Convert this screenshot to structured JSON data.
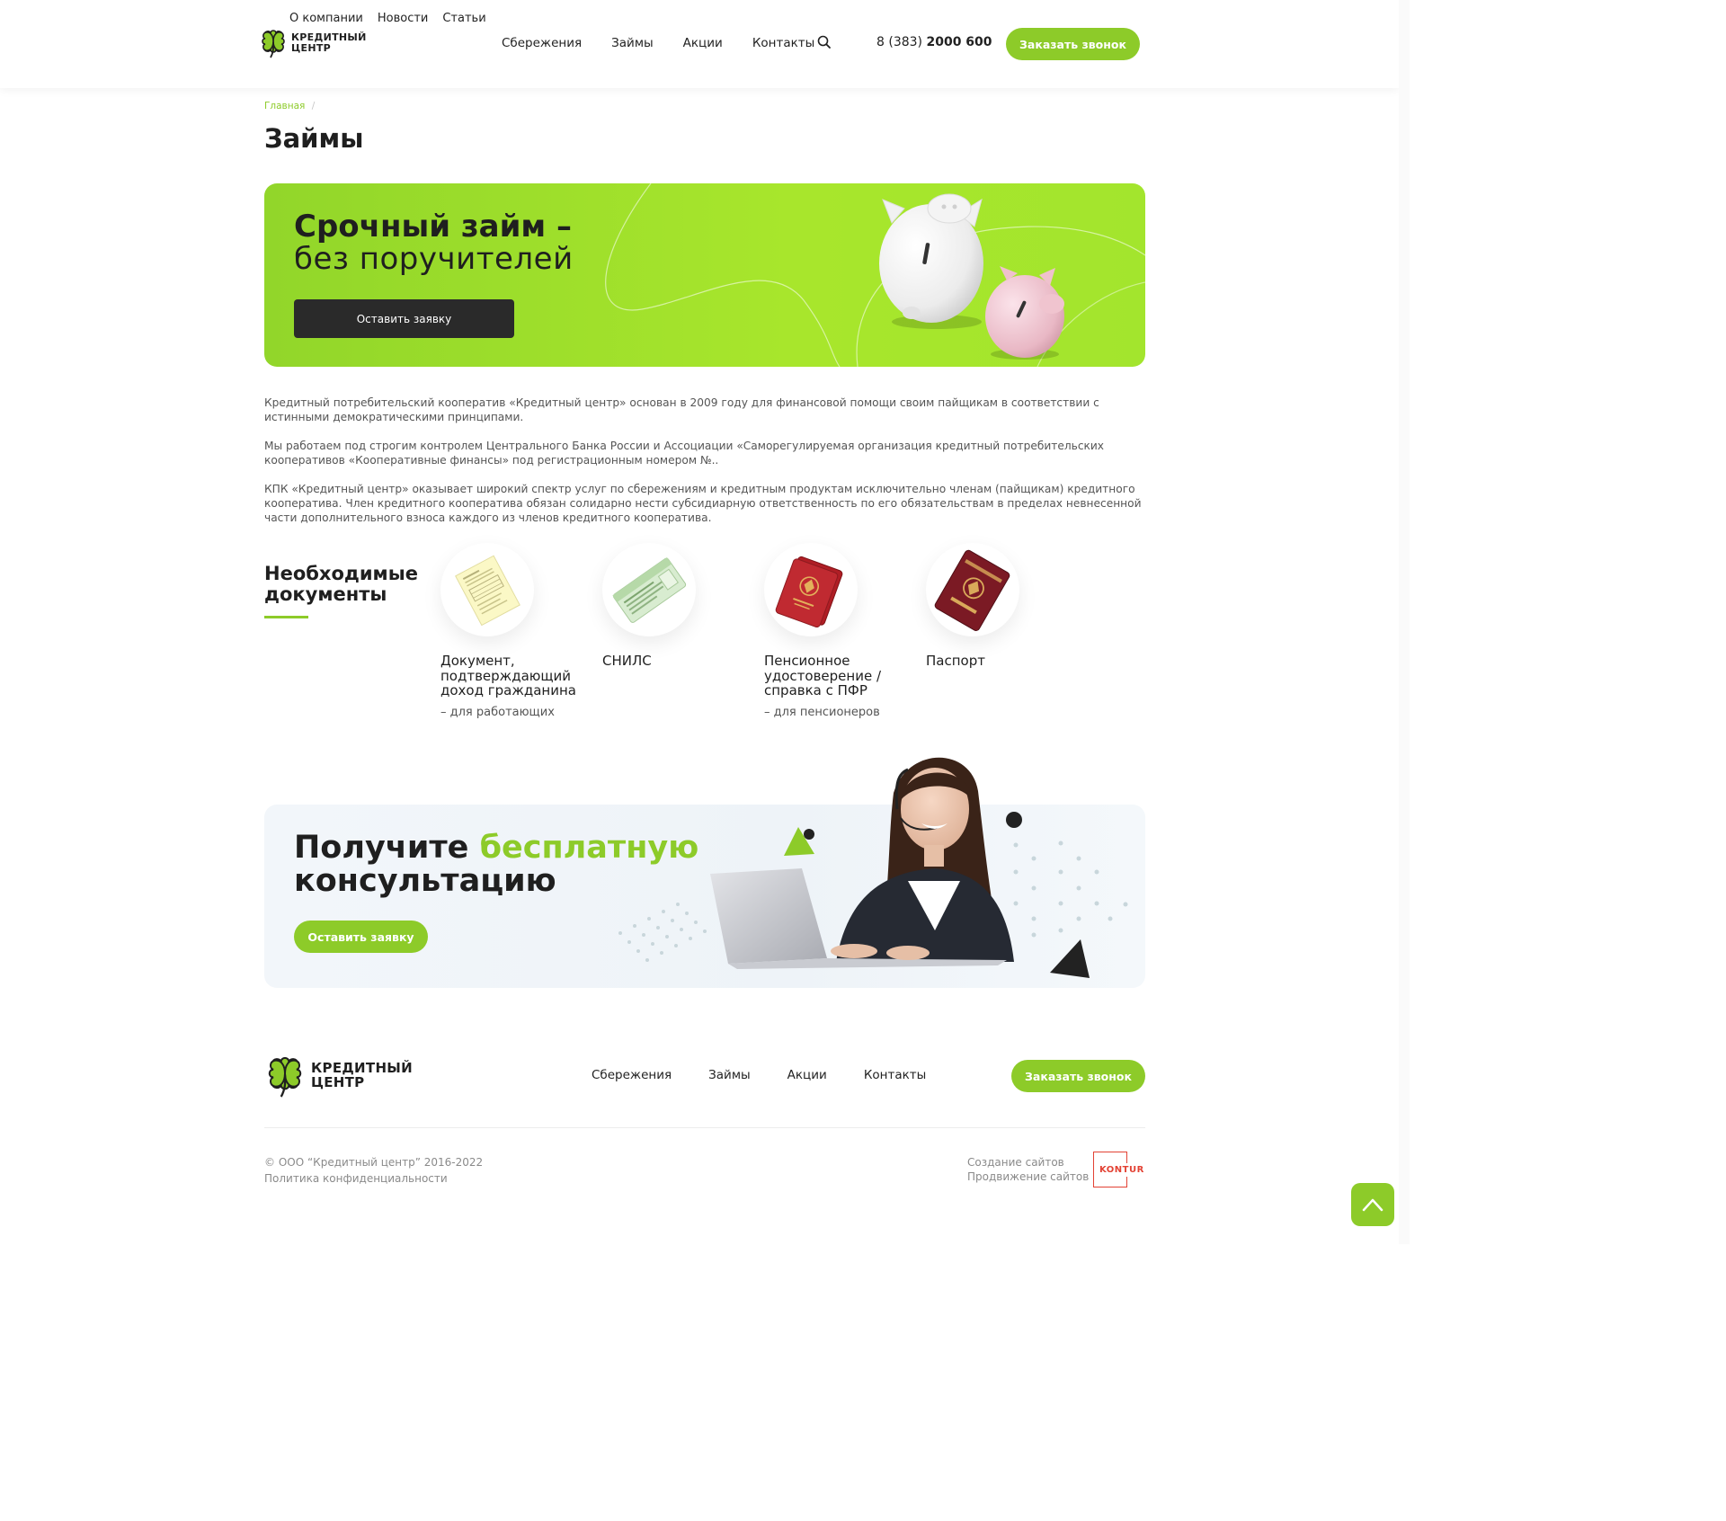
{
  "header": {
    "logo_text": [
      "КРЕДИТНЫЙ",
      "ЦЕНТР"
    ],
    "top_links": [
      "О компании",
      "Новости",
      "Статьи"
    ],
    "nav": [
      "Сбережения",
      "Займы",
      "Акции",
      "Контакты"
    ],
    "phone_prefix": "8 (383)",
    "phone_main": "2000 600",
    "call_button": "Заказать звонок"
  },
  "breadcrumb": {
    "home": "Главная",
    "separator": "/"
  },
  "page_title": "Займы",
  "hero": {
    "title_line1": "Срочный займ –",
    "title_line2": "без поручителей",
    "button": "Оставить заявку"
  },
  "about": [
    "Кредитный потребительский кооператив «Кредитный центр» основан в 2009 году для финансовой помощи своим пайщикам в соответствии с истинными демократическими принципами.",
    "Мы работаем под строгим контролем Центрального Банка России и Ассоциации «Саморегулируемая организация кредитный потребительских кооперативов «Кооперативные финансы» под регистрационным номером №..",
    "КПК «Кредитный центр» оказывает широкий спектр услуг по сбережениям и кредитным продуктам исключительно членам (пайщикам) кредитного кооператива. Член кредитного кооператива обязан солидарно нести субсидиарную ответственность по его обязательствам в пределах невнесенной части дополнительного взноса каждого из членов кредитного кооператива."
  ],
  "documents": {
    "heading_line1": "Необходимые",
    "heading_line2": "документы",
    "items": [
      {
        "title": "Документ, подтверждающий доход гражданина",
        "note": "– для работающих"
      },
      {
        "title": "СНИЛС",
        "note": ""
      },
      {
        "title": "Пенсионное удостоверение / справка с ПФР",
        "note": "– для пенсионеров"
      },
      {
        "title": "Паспорт",
        "note": ""
      }
    ]
  },
  "consultation": {
    "title_part1": "Получите ",
    "title_accent": "бесплатную",
    "title_line2": "консультацию",
    "button": "Оставить заявку"
  },
  "footer": {
    "logo_text": [
      "КРЕДИТНЫЙ",
      "ЦЕНТР"
    ],
    "nav": [
      "Сбережения",
      "Займы",
      "Акции",
      "Контакты"
    ],
    "call_button": "Заказать звонок",
    "copyright": "© ООО “Кредитный центр” 2016-2022",
    "privacy": "Политика конфиденциальности",
    "dev_line1": "Создание сайтов",
    "dev_line2": "Продвижение сайтов",
    "dev_logo": "KONTUR"
  },
  "colors": {
    "accent": "#8dcb29",
    "dark": "#2a2a2a",
    "text": "#1f1f1f",
    "muted": "#8a8a8a",
    "kontur": "#e34234"
  },
  "icons": [
    "clover-logo-icon",
    "search-icon",
    "piggy-bank-illustration",
    "income-document-icon",
    "snils-card-icon",
    "pension-certificate-icon",
    "passport-icon",
    "operator-illustration",
    "arrow-up-icon"
  ]
}
